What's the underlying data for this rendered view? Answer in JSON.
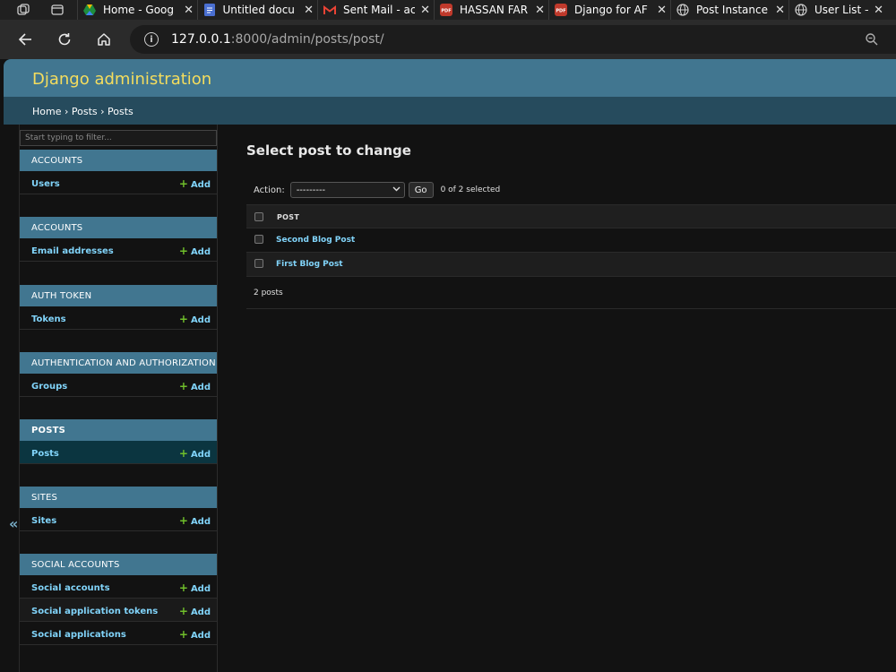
{
  "browser": {
    "tabs": [
      {
        "title": "Home - Goog",
        "favicon": "google-drive-icon",
        "color": "#4285f4"
      },
      {
        "title": "Untitled docu",
        "favicon": "google-docs-icon",
        "color": "#4a6fd1"
      },
      {
        "title": "Sent Mail - ac",
        "favicon": "gmail-icon",
        "color": "#ea4335"
      },
      {
        "title": "HASSAN FAR",
        "favicon": "pdf-icon",
        "color": "#c0392b"
      },
      {
        "title": "Django for AF",
        "favicon": "pdf-icon",
        "color": "#c0392b"
      },
      {
        "title": "Post Instance",
        "favicon": "globe-icon",
        "color": "#d0d0d0"
      },
      {
        "title": "User List – Dj",
        "favicon": "globe-icon",
        "color": "#d0d0d0"
      }
    ],
    "url_host": "127.0.0.1",
    "url_path": ":8000/admin/posts/post/"
  },
  "header": {
    "site_title": "Django administration"
  },
  "breadcrumbs": {
    "home": "Home",
    "app": "Posts",
    "model": "Posts",
    "separator": "›"
  },
  "sidebar": {
    "filter_placeholder": "Start typing to filter...",
    "add_label": "Add",
    "collapse_glyph": "«",
    "apps": [
      {
        "caption": "ACCOUNTS",
        "models": [
          {
            "name": "Users"
          }
        ]
      },
      {
        "caption": "ACCOUNTS",
        "models": [
          {
            "name": "Email addresses"
          }
        ]
      },
      {
        "caption": "AUTH TOKEN",
        "models": [
          {
            "name": "Tokens"
          }
        ]
      },
      {
        "caption": "AUTHENTICATION AND AUTHORIZATION",
        "models": [
          {
            "name": "Groups"
          }
        ]
      },
      {
        "caption": "POSTS",
        "current": true,
        "models": [
          {
            "name": "Posts",
            "active": true
          }
        ]
      },
      {
        "caption": "SITES",
        "models": [
          {
            "name": "Sites"
          }
        ]
      },
      {
        "caption": "SOCIAL ACCOUNTS",
        "models": [
          {
            "name": "Social accounts"
          },
          {
            "name": "Social application tokens"
          },
          {
            "name": "Social applications"
          }
        ]
      }
    ]
  },
  "content": {
    "title": "Select post to change",
    "action_label": "Action:",
    "action_selected": "---------",
    "go_label": "Go",
    "selection_counter": "0 of 2 selected",
    "column_header": "POST",
    "rows": [
      "Second Blog Post",
      "First Blog Post"
    ],
    "paginator": "2 posts"
  },
  "colors": {
    "header": "#417690",
    "breadcrumbs": "#264b5d",
    "site_title": "#f5dd5d",
    "link": "#81d4fa",
    "add_plus": "#70bf2b"
  }
}
